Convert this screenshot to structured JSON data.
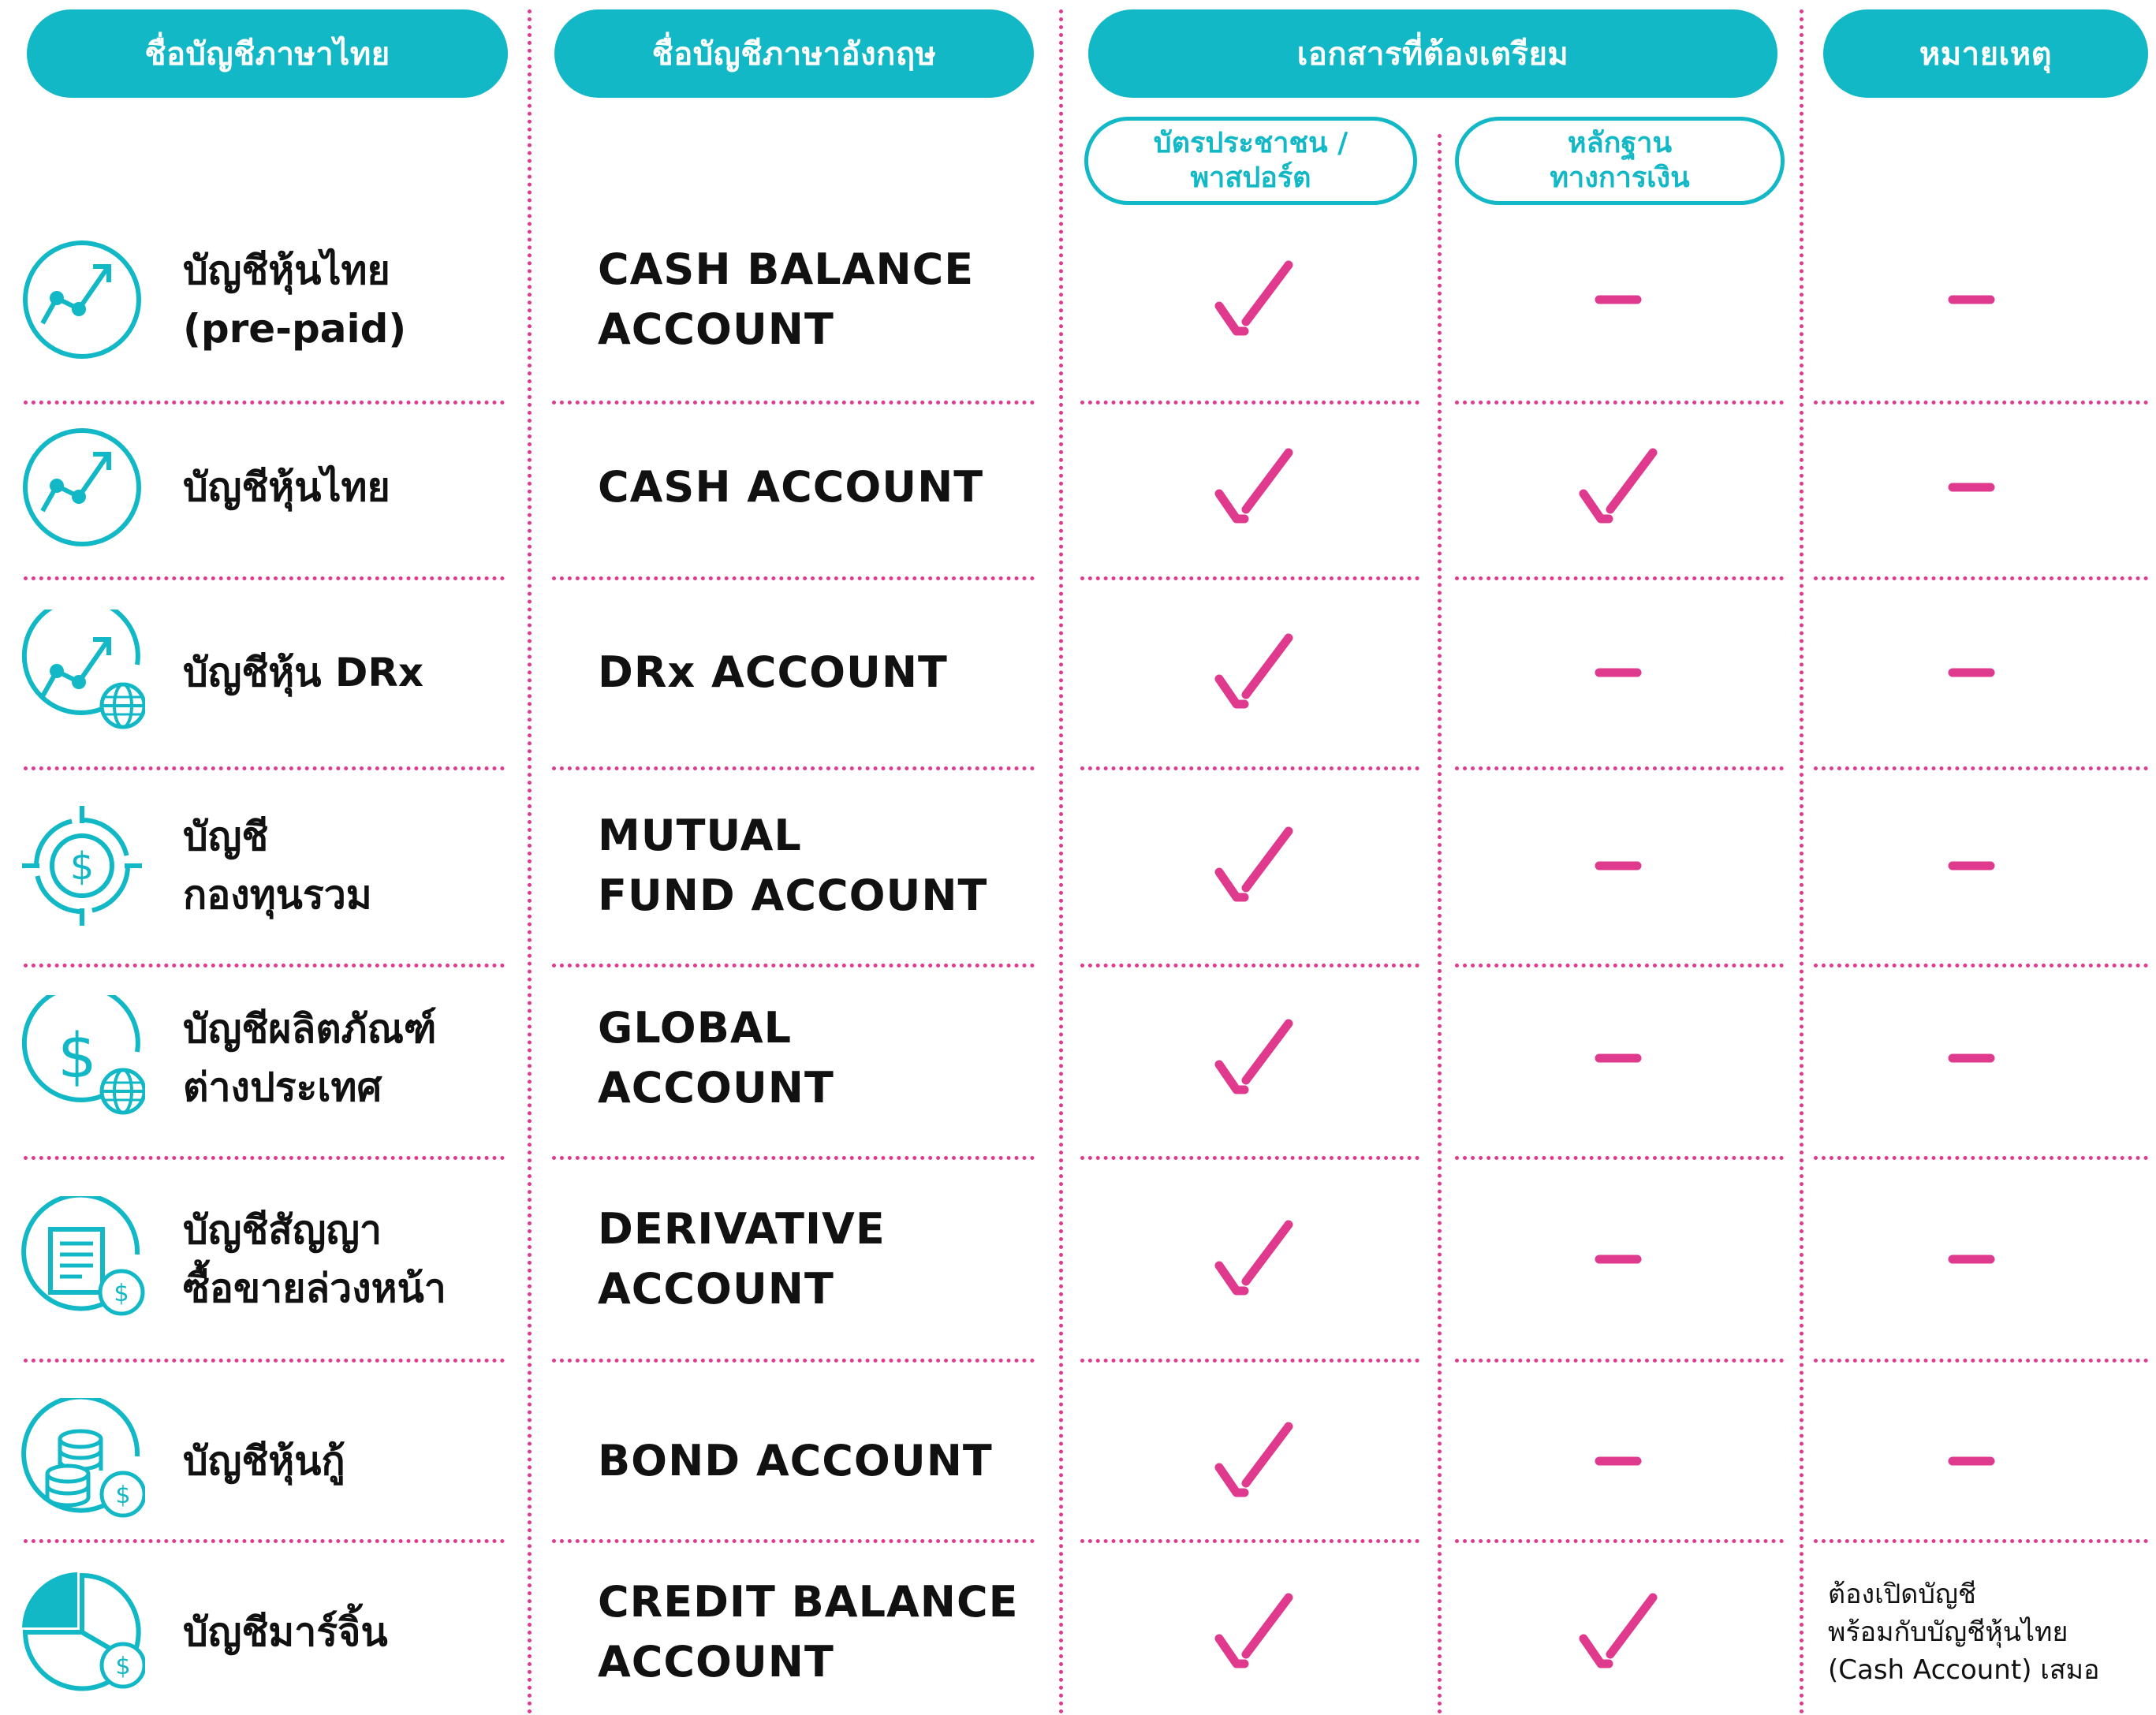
{
  "headers": {
    "thai_name": "ชื่อบัญชีภาษาไทย",
    "english_name": "ชื่อบัญชีภาษาอังกฤษ",
    "documents": "เอกสารที่ต้องเตรียม",
    "remark": "หมายเหตุ",
    "id_card": "บัตรประชาชน /\nพาสปอร์ต",
    "financial_proof": "หลักฐาน\nทางการเงิน"
  },
  "rows": [
    {
      "icon": "stock-chart-icon",
      "thai": "บัญชีหุ้นไทย\n(pre-paid)",
      "english": "CASH BALANCE\nACCOUNT",
      "id_card": "check",
      "financial": "dash",
      "remark": "dash"
    },
    {
      "icon": "stock-chart-icon",
      "thai": "บัญชีหุ้นไทย",
      "english": "CASH ACCOUNT",
      "id_card": "check",
      "financial": "check",
      "remark": "dash"
    },
    {
      "icon": "stock-chart-globe-icon",
      "thai": "บัญชีหุ้น DRx",
      "english": "DRx ACCOUNT",
      "id_card": "check",
      "financial": "dash",
      "remark": "dash"
    },
    {
      "icon": "dollar-target-icon",
      "thai": "บัญชี\nกองทุนรวม",
      "english": "MUTUAL\nFUND ACCOUNT",
      "id_card": "check",
      "financial": "dash",
      "remark": "dash"
    },
    {
      "icon": "dollar-globe-icon",
      "thai": "บัญชีผลิตภัณฑ์\nต่างประเทศ",
      "english": "GLOBAL ACCOUNT",
      "id_card": "check",
      "financial": "dash",
      "remark": "dash"
    },
    {
      "icon": "document-coin-icon",
      "thai": "บัญชีสัญญา\nซื้อขายล่วงหน้า",
      "english": "DERIVATIVE\nACCOUNT",
      "id_card": "check",
      "financial": "dash",
      "remark": "dash"
    },
    {
      "icon": "coin-stack-icon",
      "thai": "บัญชีหุ้นกู้",
      "english": "BOND ACCOUNT",
      "id_card": "check",
      "financial": "dash",
      "remark": "dash"
    },
    {
      "icon": "pie-chart-coin-icon",
      "thai": "บัญชีมาร์จิ้น",
      "english": "CREDIT BALANCE\nACCOUNT",
      "id_card": "check",
      "financial": "check",
      "remark": "ต้องเปิดบัญชี\nพร้อมกับบัญชีหุ้นไทย\n(Cash Account) เสมอ"
    }
  ],
  "colors": {
    "accent": "#12b8c6",
    "mark": "#e03a8f",
    "text": "#111111"
  }
}
